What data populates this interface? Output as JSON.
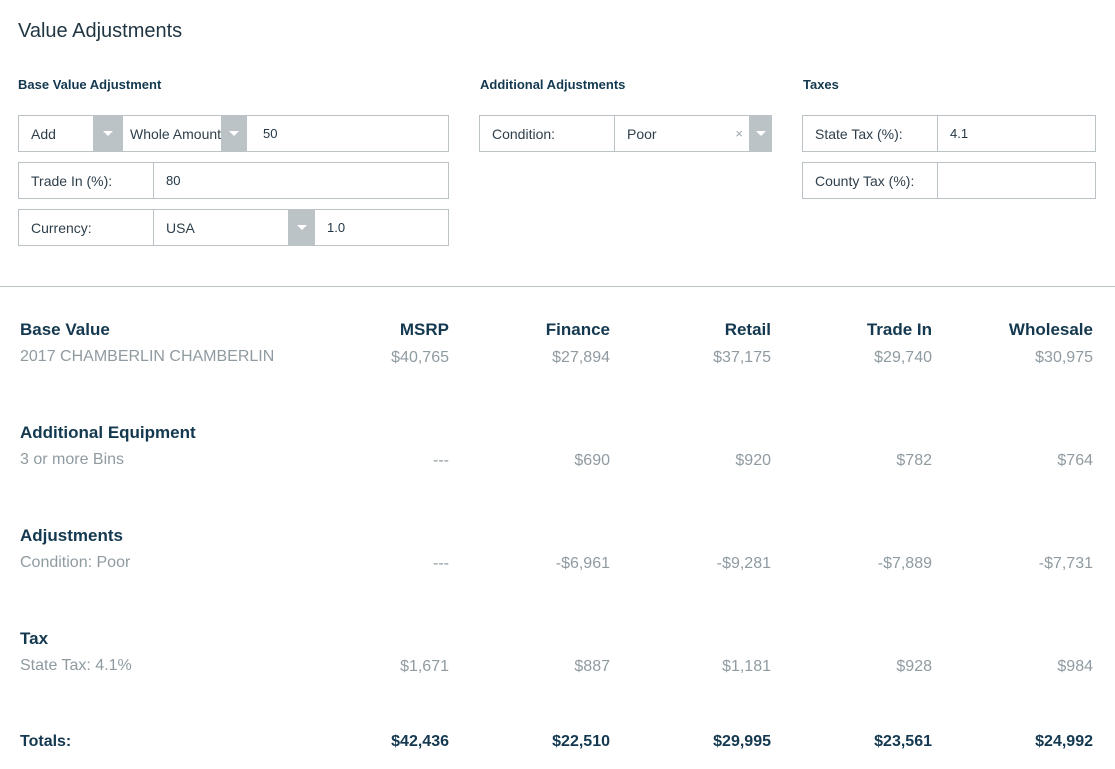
{
  "title": "Value Adjustments",
  "base_value_adjustment": {
    "heading": "Base Value Adjustment",
    "operation_select": "Add",
    "amount_type_select": "Whole Amount",
    "amount_value": "50",
    "trade_in_label": "Trade In (%):",
    "trade_in_value": "80",
    "currency_label": "Currency:",
    "currency_select": "USA",
    "currency_rate": "1.0"
  },
  "additional_adjustments": {
    "heading": "Additional Adjustments",
    "condition_label": "Condition:",
    "condition_select": "Poor",
    "clear_icon": "×"
  },
  "taxes": {
    "heading": "Taxes",
    "state_tax_label": "State Tax (%):",
    "state_tax_value": "4.1",
    "county_tax_label": "County Tax (%):",
    "county_tax_value": ""
  },
  "table": {
    "columns": [
      "MSRP",
      "Finance",
      "Retail",
      "Trade In",
      "Wholesale"
    ],
    "sections": [
      {
        "heading": "Base Value",
        "label": "2017 CHAMBERLIN CHAMBERLIN",
        "values": [
          "$40,765",
          "$27,894",
          "$37,175",
          "$29,740",
          "$30,975"
        ]
      },
      {
        "heading": "Additional Equipment",
        "label": "3 or more Bins",
        "values": [
          "---",
          "$690",
          "$920",
          "$782",
          "$764"
        ]
      },
      {
        "heading": "Adjustments",
        "label": "Condition: Poor",
        "values": [
          "---",
          "-$6,961",
          "-$9,281",
          "-$7,889",
          "-$7,731"
        ]
      },
      {
        "heading": "Tax",
        "label": "State Tax: 4.1%",
        "values": [
          "$1,671",
          "$887",
          "$1,181",
          "$928",
          "$984"
        ]
      }
    ],
    "totals_label": "Totals:",
    "totals": [
      "$42,436",
      "$22,510",
      "$29,995",
      "$23,561",
      "$24,992"
    ]
  }
}
